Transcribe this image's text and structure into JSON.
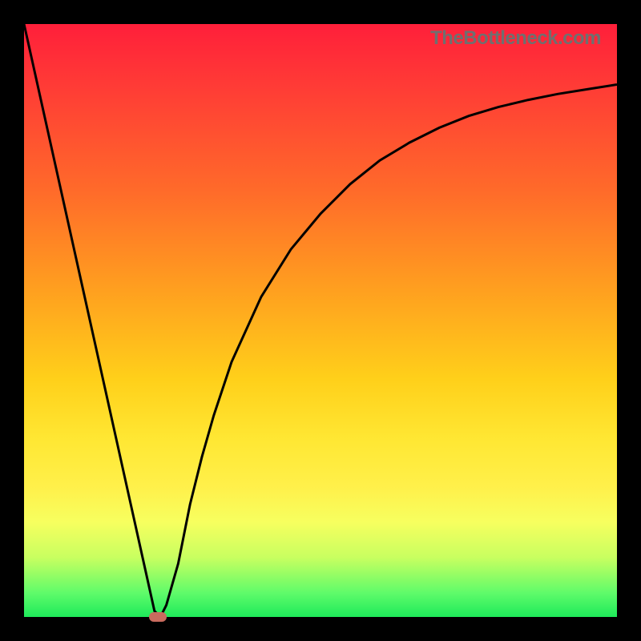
{
  "watermark": "TheBottleneck.com",
  "colors": {
    "curve_stroke": "#000000",
    "marker_fill": "#c96b5e",
    "frame_bg": "#000000"
  },
  "chart_data": {
    "type": "line",
    "title": "",
    "xlabel": "",
    "ylabel": "",
    "xlim": [
      0,
      100
    ],
    "ylim": [
      0,
      100
    ],
    "x": [
      0,
      2,
      4,
      6,
      8,
      10,
      12,
      14,
      16,
      18,
      20,
      22,
      23,
      24,
      26,
      28,
      30,
      32,
      35,
      40,
      45,
      50,
      55,
      60,
      65,
      70,
      75,
      80,
      85,
      90,
      95,
      100
    ],
    "values": [
      100,
      91,
      82,
      73,
      64,
      55,
      46,
      37,
      28,
      19,
      10,
      1,
      0,
      2,
      9,
      19,
      27,
      34,
      43,
      54,
      62,
      68,
      73,
      77,
      80,
      82.5,
      84.5,
      86,
      87.2,
      88.2,
      89,
      89.8
    ],
    "marker": {
      "x": 22.5,
      "y": 0
    },
    "grid": false,
    "legend": false
  }
}
